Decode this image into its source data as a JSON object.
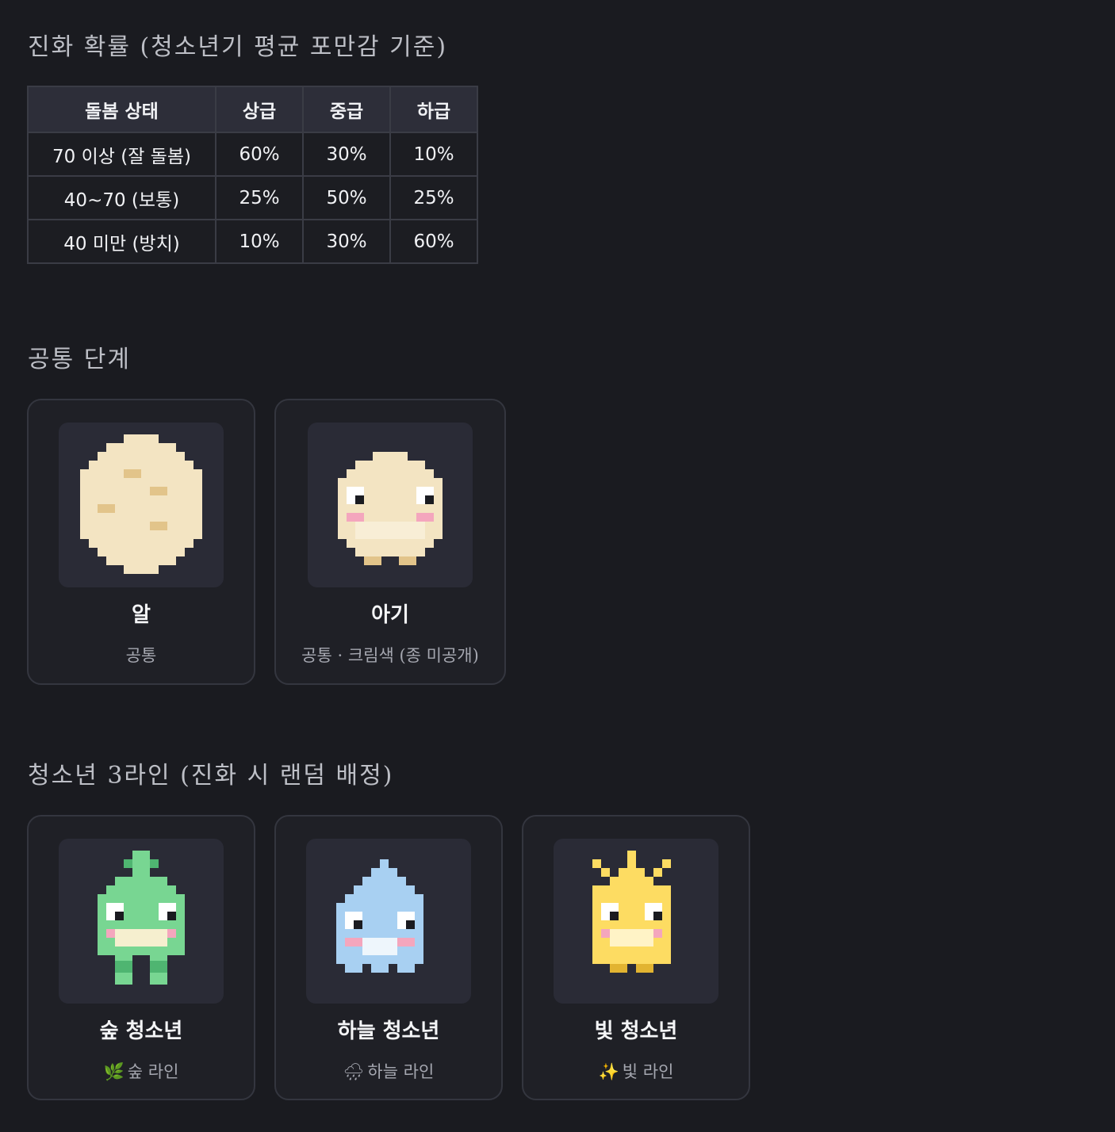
{
  "probability_section": {
    "title": "진화 확률 (청소년기 평균 포만감 기준)",
    "headers": [
      "돌봄 상태",
      "상급",
      "중급",
      "하급"
    ],
    "rows": [
      [
        "70 이상 (잘 돌봄)",
        "60%",
        "30%",
        "10%"
      ],
      [
        "40~70 (보통)",
        "25%",
        "50%",
        "25%"
      ],
      [
        "40 미만 (방치)",
        "10%",
        "30%",
        "60%"
      ]
    ]
  },
  "common_section": {
    "title": "공통 단계",
    "cards": [
      {
        "name": "알",
        "subtitle": "공통",
        "sprite": "egg-sprite"
      },
      {
        "name": "아기",
        "subtitle": "공통 · 크림색 (종 미공개)",
        "sprite": "baby-sprite"
      }
    ]
  },
  "teen_section": {
    "title": "청소년 3라인 (진화 시 랜덤 배정)",
    "cards": [
      {
        "name": "숲 청소년",
        "emoji": "🌿",
        "subtitle": "숲 라인",
        "sprite": "forest-teen-sprite"
      },
      {
        "name": "하늘 청소년",
        "emoji": "🌧",
        "subtitle": "하늘 라인",
        "sprite": "sky-teen-sprite"
      },
      {
        "name": "빛 청소년",
        "emoji": "✨",
        "subtitle": "빛 라인",
        "sprite": "light-teen-sprite"
      }
    ]
  },
  "colors": {
    "background": "#1a1b20",
    "card_background": "#1f2026",
    "portrait_background": "#2a2b36",
    "egg_cream": "#f3e4c2",
    "egg_spot": "#e2c48a",
    "forest_green": "#78d692",
    "sky_blue": "#a8d0f2",
    "light_yellow": "#fddc62",
    "blush_pink": "#f4a6bd"
  }
}
